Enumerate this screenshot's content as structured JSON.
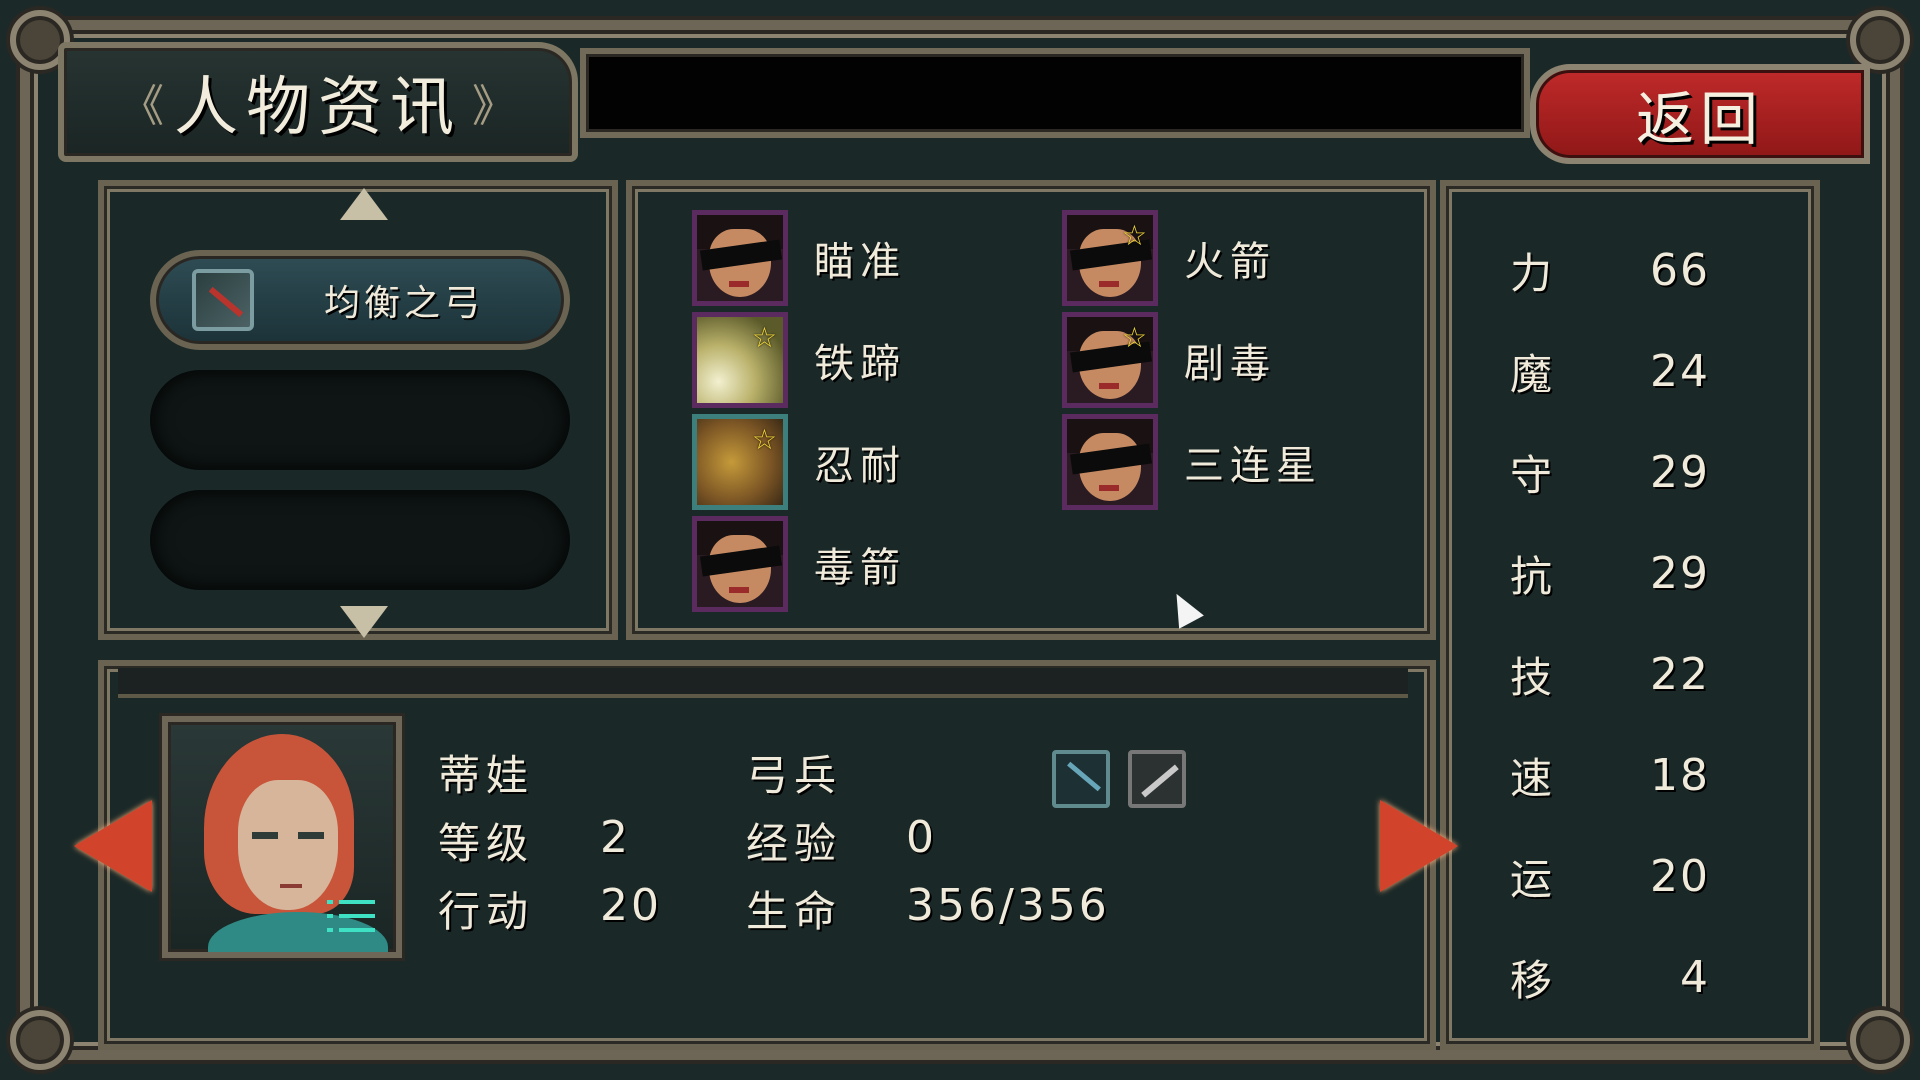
{
  "title": {
    "text": "人物资讯",
    "left_deco": "《",
    "right_deco": "》"
  },
  "back_button": {
    "label": "返回"
  },
  "equipment": {
    "slots": [
      {
        "label": "均衡之弓",
        "icon": "bow-icon"
      }
    ]
  },
  "skills": [
    {
      "name": "瞄准",
      "icon": "masked-archer-icon",
      "starred": false
    },
    {
      "name": "火箭",
      "icon": "masked-archer-icon",
      "starred": true
    },
    {
      "name": "铁蹄",
      "icon": "light-burst-icon",
      "starred": true
    },
    {
      "name": "剧毒",
      "icon": "masked-archer-icon",
      "starred": true
    },
    {
      "name": "忍耐",
      "icon": "bear-icon",
      "starred": true
    },
    {
      "name": "三连星",
      "icon": "masked-archer-icon",
      "starred": false
    },
    {
      "name": "毒箭",
      "icon": "masked-archer-icon",
      "starred": false
    }
  ],
  "stats": [
    {
      "label": "力",
      "value": "66"
    },
    {
      "label": "魔",
      "value": "24"
    },
    {
      "label": "守",
      "value": "29"
    },
    {
      "label": "抗",
      "value": "29"
    },
    {
      "label": "技",
      "value": "22"
    },
    {
      "label": "速",
      "value": "18"
    },
    {
      "label": "运",
      "value": "20"
    },
    {
      "label": "移",
      "value": "4"
    }
  ],
  "character": {
    "name": "蒂娃",
    "class": "弓兵",
    "level_label": "等级",
    "level": "2",
    "exp_label": "经验",
    "exp": "0",
    "action_label": "行动",
    "action": "20",
    "hp_label": "生命",
    "hp": "356/356"
  },
  "colors": {
    "accent_red": "#c02a2a",
    "panel_bg": "#1a2928",
    "frame": "#6d6656",
    "menu_icon": "#3ee1c4",
    "star": "#f4d836"
  }
}
